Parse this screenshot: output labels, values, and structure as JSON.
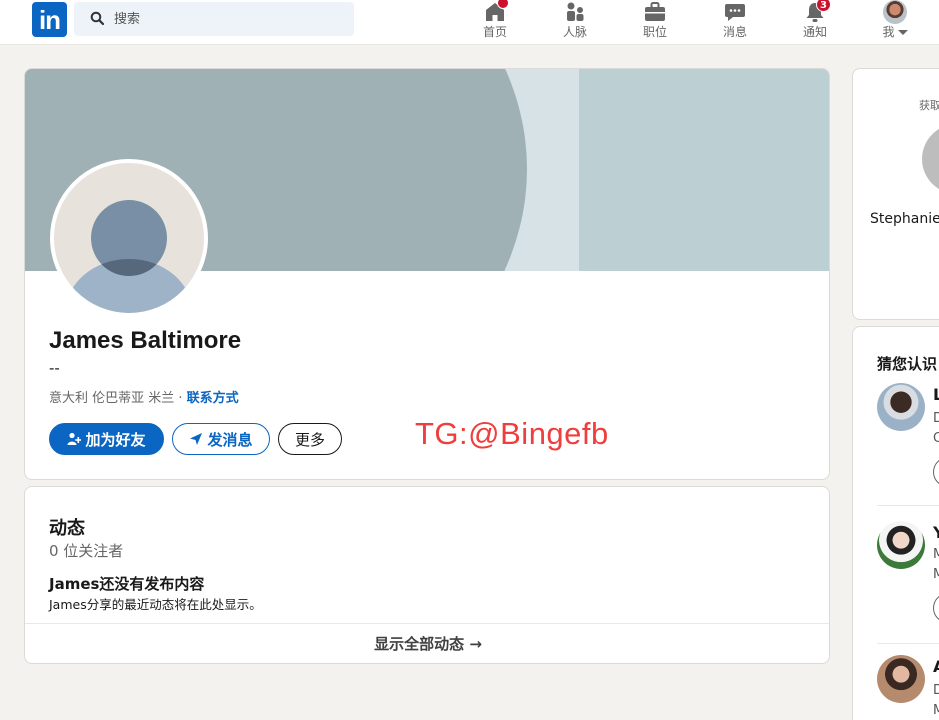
{
  "nav": {
    "logo": "in",
    "search_placeholder": "搜索",
    "items": [
      {
        "label": "首页",
        "badge": "",
        "icon": "home-icon"
      },
      {
        "label": "人脉",
        "badge": "",
        "icon": "network-icon"
      },
      {
        "label": "职位",
        "badge": "",
        "icon": "briefcase-icon"
      },
      {
        "label": "消息",
        "badge": "",
        "icon": "chat-icon"
      },
      {
        "label": "通知",
        "badge": "3",
        "icon": "bell-icon"
      },
      {
        "label": "我",
        "icon": "avatar"
      }
    ]
  },
  "profile": {
    "name": "James Baltimore",
    "headline": "--",
    "location": "意大利 伦巴蒂亚 米兰 · ",
    "contact_link": "联系方式",
    "buttons": {
      "connect": "加为好友",
      "message": "发消息",
      "more": "更多"
    },
    "watermark": "TG:@Bingefb"
  },
  "activity": {
    "title": "动态",
    "followers": "0 位关注者",
    "empty_title": "James还没有发布内容",
    "empty_desc": "James分享的最近动态将在此处显示。",
    "show_all": "显示全部动态 →"
  },
  "sidebar": {
    "card1": {
      "label": "获取",
      "name": "Stephanie"
    },
    "card2": {
      "title": "猜您认识",
      "people": [
        {
          "initial": "L",
          "line1": "D",
          "line2": "O"
        },
        {
          "initial": "Y",
          "line1": "M",
          "line2": "M"
        },
        {
          "initial": "A",
          "line1": "D",
          "line2": "M"
        }
      ]
    }
  },
  "colors": {
    "brand": "#0a66c2",
    "badge": "#cb112d",
    "watermark": "#ef3e3e"
  }
}
